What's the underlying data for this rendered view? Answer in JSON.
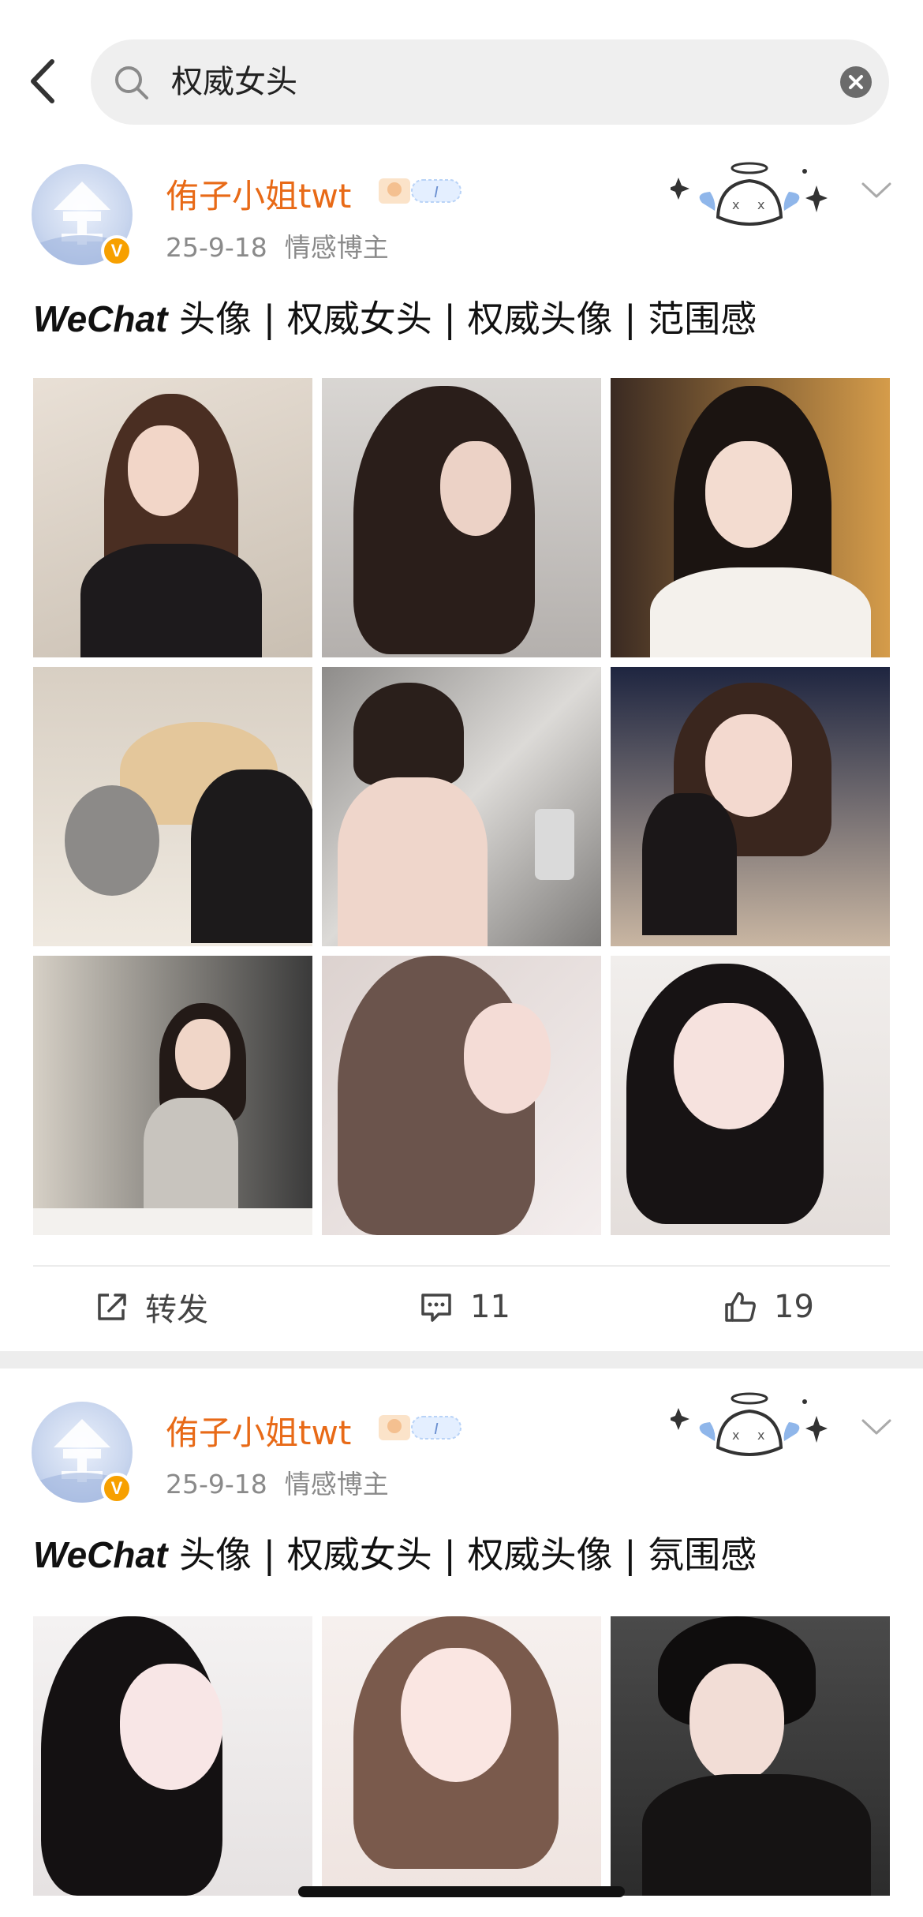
{
  "search": {
    "query": "权威女头"
  },
  "posts": [
    {
      "username": "侑子小姐twt",
      "date": "25-9-18",
      "category": "情感博主",
      "badge": "V",
      "text_brand": "WeChat",
      "text_rest": " 头像 | 权威女头 | 权威头像 | 范围感",
      "actions": {
        "repost_label": "转发",
        "comment_count": "11",
        "like_count": "19"
      }
    },
    {
      "username": "侑子小姐twt",
      "date": "25-9-18",
      "category": "情感博主",
      "badge": "V",
      "text_brand": "WeChat",
      "text_rest": " 头像 | 权威女头 | 权威头像 | 氛围感"
    }
  ],
  "colors": {
    "accent_username": "#e86a17",
    "verified_badge": "#f7a000",
    "separator": "#ededed"
  }
}
